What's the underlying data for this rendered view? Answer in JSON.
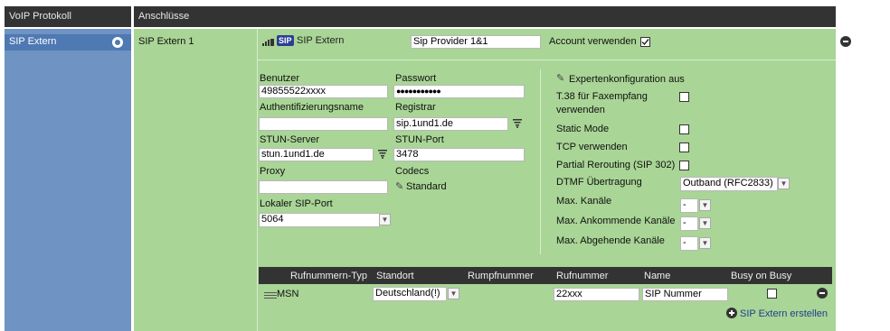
{
  "header": {
    "left_title": "VoIP Protokoll",
    "right_title": "Anschlüsse"
  },
  "sidebar": {
    "selected_item": "SIP Extern"
  },
  "connection": {
    "name": "SIP Extern 1",
    "type_label": "SIP Extern",
    "sip_badge": "SIP",
    "provider": "Sip Provider 1&1",
    "account_use_label": "Account verwenden",
    "account_use_checked": true
  },
  "form": {
    "user_label": "Benutzer",
    "user_value": "49855522xxxx",
    "password_label": "Passwort",
    "password_value": "●●●●●●●●●●●",
    "auth_label": "Authentifizierungsname",
    "auth_value": "",
    "registrar_label": "Registrar",
    "registrar_value": "sip.1und1.de",
    "stun_server_label": "STUN-Server",
    "stun_server_value": "stun.1und1.de",
    "stun_port_label": "STUN-Port",
    "stun_port_value": "3478",
    "proxy_label": "Proxy",
    "proxy_value": "",
    "codecs_label": "Codecs",
    "codecs_value": "Standard",
    "local_port_label": "Lokaler SIP-Port",
    "local_port_value": "5064"
  },
  "expert": {
    "toggle_label": "Expertenkonfiguration aus",
    "t38_label_1": "T.38 für Faxempfang",
    "t38_label_2": "verwenden",
    "static_mode_label": "Static Mode",
    "tcp_label": "TCP verwenden",
    "partial_rerouting_label": "Partial Rerouting (SIP 302)",
    "dtmf_label": "DTMF Übertragung",
    "dtmf_value": "Outband (RFC2833)",
    "max_channels_label": "Max. Kanäle",
    "max_channels_value": "-",
    "max_incoming_label": "Max. Ankommende Kanäle",
    "max_incoming_value": "-",
    "max_outgoing_label": "Max. Abgehende Kanäle",
    "max_outgoing_value": "-"
  },
  "numbers_table": {
    "columns": [
      "Rufnummern-Typ",
      "Standort",
      "Rumpfnummer",
      "Rufnummer",
      "Name",
      "Busy on Busy"
    ],
    "row": {
      "type": "MSN",
      "location": "Deutschland(!)",
      "trunk": "",
      "number": "22xxx",
      "name": "SIP Nummer"
    }
  },
  "create_link": "SIP Extern erstellen"
}
